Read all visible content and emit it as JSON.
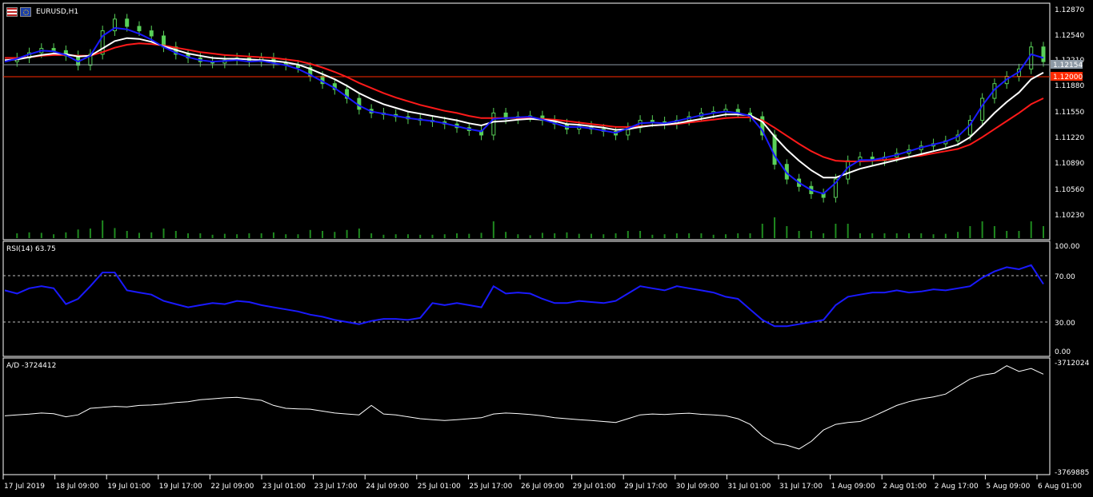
{
  "window": {
    "symbol_title": "EURUSD,H1",
    "colors": {
      "background": "#000000",
      "grid": "#ffffff",
      "price_line": "#8e9aa6",
      "level_line": "#ff2a00",
      "candle_up": "#59d159",
      "ma_fast": "#1a1aff",
      "ma_mid": "#ffffff",
      "ma_slow": "#ff1a1a",
      "rsi": "#1a1aff",
      "ad": "#ffffff",
      "volume": "#1f8a1f"
    }
  },
  "price_panel": {
    "current_price_label": "1.12154",
    "level_label": "1.12000",
    "axis_ticks": [
      "1.12870",
      "1.12540",
      "1.12210",
      "1.11880",
      "1.11550",
      "1.11220",
      "1.10890",
      "1.10560",
      "1.10230"
    ]
  },
  "rsi_panel": {
    "indicator_label": "RSI(14) 63.75",
    "axis_ticks": [
      "100.00",
      "70.00",
      "30.00",
      "0.00"
    ],
    "levels": [
      70,
      30
    ]
  },
  "ad_panel": {
    "indicator_label": "A/D -3724412",
    "axis_ticks": [
      "-3712024",
      "-3769885"
    ]
  },
  "time_axis": {
    "labels": [
      "17 Jul 2019",
      "18 Jul 09:00",
      "19 Jul 01:00",
      "19 Jul 17:00",
      "22 Jul 09:00",
      "23 Jul 01:00",
      "23 Jul 17:00",
      "24 Jul 09:00",
      "25 Jul 01:00",
      "25 Jul 17:00",
      "26 Jul 09:00",
      "29 Jul 01:00",
      "29 Jul 17:00",
      "30 Jul 09:00",
      "31 Jul 01:00",
      "31 Jul 17:00",
      "1 Aug 09:00",
      "2 Aug 01:00",
      "2 Aug 17:00",
      "5 Aug 09:00",
      "6 Aug 01:00"
    ]
  },
  "chart_data": {
    "type": "line",
    "symbol": "EURUSD",
    "timeframe": "H1",
    "price_ylim": [
      1.101,
      1.1292
    ],
    "price_close_series": [
      1.122,
      1.1225,
      1.1232,
      1.1238,
      1.1235,
      1.1228,
      1.1215,
      1.123,
      1.1262,
      1.1278,
      1.1268,
      1.1262,
      1.1255,
      1.124,
      1.123,
      1.1225,
      1.122,
      1.1218,
      1.1222,
      1.1225,
      1.122,
      1.1225,
      1.1218,
      1.1215,
      1.1212,
      1.12,
      1.119,
      1.1182,
      1.117,
      1.1155,
      1.115,
      1.1148,
      1.1145,
      1.1142,
      1.114,
      1.1138,
      1.1135,
      1.113,
      1.1126,
      1.112,
      1.115,
      1.1142,
      1.1145,
      1.1146,
      1.114,
      1.1135,
      1.1128,
      1.1132,
      1.1128,
      1.1125,
      1.112,
      1.113,
      1.114,
      1.1138,
      1.1135,
      1.114,
      1.1145,
      1.115,
      1.1152,
      1.1155,
      1.115,
      1.1145,
      1.112,
      1.108,
      1.106,
      1.105,
      1.104,
      1.1035,
      1.106,
      1.1085,
      1.109,
      1.1085,
      1.109,
      1.1095,
      1.11,
      1.1105,
      1.1108,
      1.1112,
      1.112,
      1.114,
      1.117,
      1.119,
      1.12,
      1.121,
      1.124,
      1.122
    ],
    "ma_fast_series": [
      1.122,
      1.1224,
      1.123,
      1.1235,
      1.1234,
      1.1229,
      1.122,
      1.1228,
      1.1255,
      1.1266,
      1.1264,
      1.1258,
      1.125,
      1.124,
      1.1232,
      1.1226,
      1.1222,
      1.122,
      1.1221,
      1.1222,
      1.122,
      1.1221,
      1.1218,
      1.1215,
      1.121,
      1.1202,
      1.1193,
      1.1184,
      1.1172,
      1.116,
      1.1152,
      1.1149,
      1.1146,
      1.1143,
      1.1141,
      1.1139,
      1.1136,
      1.1132,
      1.1128,
      1.1125,
      1.1142,
      1.1143,
      1.1144,
      1.1145,
      1.1141,
      1.1136,
      1.1131,
      1.1131,
      1.1129,
      1.1126,
      1.1123,
      1.1129,
      1.1136,
      1.1137,
      1.1136,
      1.1139,
      1.1143,
      1.1147,
      1.115,
      1.1152,
      1.115,
      1.1146,
      1.1126,
      1.1092,
      1.1068,
      1.1055,
      1.1045,
      1.104,
      1.1055,
      1.1076,
      1.1086,
      1.1086,
      1.1089,
      1.1093,
      1.1098,
      1.1103,
      1.1107,
      1.1111,
      1.1118,
      1.1134,
      1.116,
      1.1182,
      1.1196,
      1.1206,
      1.123,
      1.1225
    ],
    "ma_mid_series": [
      1.1222,
      1.1223,
      1.1226,
      1.1229,
      1.1231,
      1.123,
      1.1227,
      1.1228,
      1.1238,
      1.1248,
      1.1252,
      1.1251,
      1.1247,
      1.1241,
      1.1236,
      1.1231,
      1.1228,
      1.1225,
      1.1224,
      1.1224,
      1.1223,
      1.1222,
      1.1221,
      1.1219,
      1.1216,
      1.121,
      1.1203,
      1.1196,
      1.1187,
      1.1177,
      1.1169,
      1.1162,
      1.1157,
      1.1152,
      1.1149,
      1.1146,
      1.1143,
      1.114,
      1.1136,
      1.1133,
      1.1138,
      1.1139,
      1.1141,
      1.1142,
      1.1141,
      1.1139,
      1.1135,
      1.1134,
      1.1132,
      1.113,
      1.1127,
      1.1128,
      1.1131,
      1.1133,
      1.1134,
      1.1136,
      1.1139,
      1.1142,
      1.1145,
      1.1148,
      1.1148,
      1.1147,
      1.1138,
      1.1118,
      1.11,
      1.1085,
      1.1072,
      1.1062,
      1.1062,
      1.1068,
      1.1074,
      1.1078,
      1.1082,
      1.1086,
      1.109,
      1.1094,
      1.1098,
      1.1102,
      1.1107,
      1.1117,
      1.1133,
      1.115,
      1.1165,
      1.1178,
      1.1196,
      1.1205
    ],
    "ma_slow_series": [
      1.1225,
      1.1225,
      1.1226,
      1.1228,
      1.1229,
      1.1229,
      1.1228,
      1.1228,
      1.1233,
      1.1239,
      1.1243,
      1.1245,
      1.1244,
      1.1242,
      1.1239,
      1.1236,
      1.1233,
      1.1231,
      1.1229,
      1.1228,
      1.1227,
      1.1226,
      1.1225,
      1.1223,
      1.1221,
      1.1217,
      1.1212,
      1.1206,
      1.1199,
      1.1191,
      1.1184,
      1.1177,
      1.1171,
      1.1166,
      1.1161,
      1.1157,
      1.1153,
      1.115,
      1.1146,
      1.1143,
      1.1143,
      1.1143,
      1.1143,
      1.1143,
      1.1142,
      1.1141,
      1.1139,
      1.1137,
      1.1135,
      1.1133,
      1.1131,
      1.1131,
      1.1132,
      1.1133,
      1.1134,
      1.1135,
      1.1137,
      1.1139,
      1.1141,
      1.1143,
      1.1144,
      1.1144,
      1.114,
      1.113,
      1.1119,
      1.1108,
      1.1098,
      1.109,
      1.1085,
      1.1084,
      1.1084,
      1.1085,
      1.1086,
      1.1088,
      1.109,
      1.1092,
      1.1095,
      1.1098,
      1.1101,
      1.1107,
      1.1117,
      1.1128,
      1.1139,
      1.115,
      1.1162,
      1.117
    ],
    "rsi_series": [
      58,
      55,
      60,
      62,
      60,
      45,
      50,
      62,
      75,
      75,
      58,
      56,
      54,
      48,
      45,
      42,
      44,
      46,
      45,
      48,
      47,
      44,
      42,
      40,
      38,
      35,
      33,
      30,
      28,
      26,
      29,
      31,
      31,
      30,
      32,
      46,
      44,
      46,
      44,
      42,
      62,
      55,
      56,
      55,
      50,
      46,
      46,
      48,
      47,
      46,
      48,
      55,
      62,
      60,
      58,
      62,
      60,
      58,
      56,
      52,
      50,
      40,
      30,
      24,
      24,
      26,
      28,
      30,
      44,
      52,
      54,
      56,
      56,
      58,
      56,
      57,
      59,
      58,
      60,
      62,
      70,
      76,
      80,
      78,
      82,
      64
    ],
    "ad_series": [
      -3740500,
      -3740000,
      -3739600,
      -3739000,
      -3739400,
      -3741000,
      -3740000,
      -3736500,
      -3736000,
      -3735500,
      -3735800,
      -3735000,
      -3734800,
      -3734300,
      -3733500,
      -3733000,
      -3732000,
      -3731500,
      -3731000,
      -3730700,
      -3731500,
      -3732300,
      -3735000,
      -3736500,
      -3736800,
      -3737000,
      -3738000,
      -3739000,
      -3739500,
      -3740000,
      -3735000,
      -3739500,
      -3740000,
      -3741000,
      -3742000,
      -3742500,
      -3743000,
      -3742500,
      -3742000,
      -3741500,
      -3739500,
      -3739000,
      -3739300,
      -3739800,
      -3740500,
      -3741500,
      -3742000,
      -3742500,
      -3743000,
      -3743500,
      -3744000,
      -3742000,
      -3740000,
      -3739500,
      -3739800,
      -3739400,
      -3739100,
      -3739700,
      -3740000,
      -3740500,
      -3742000,
      -3745000,
      -3751000,
      -3755000,
      -3756000,
      -3758000,
      -3754000,
      -3748000,
      -3745000,
      -3744000,
      -3743500,
      -3741000,
      -3738000,
      -3735000,
      -3733000,
      -3731500,
      -3730500,
      -3729000,
      -3725000,
      -3721000,
      -3719000,
      -3718000,
      -3714000,
      -3717000,
      -3715500,
      -3718500
    ],
    "ad_ylim": [
      -3769885,
      -3712024
    ],
    "legend": "none",
    "grid": false
  }
}
